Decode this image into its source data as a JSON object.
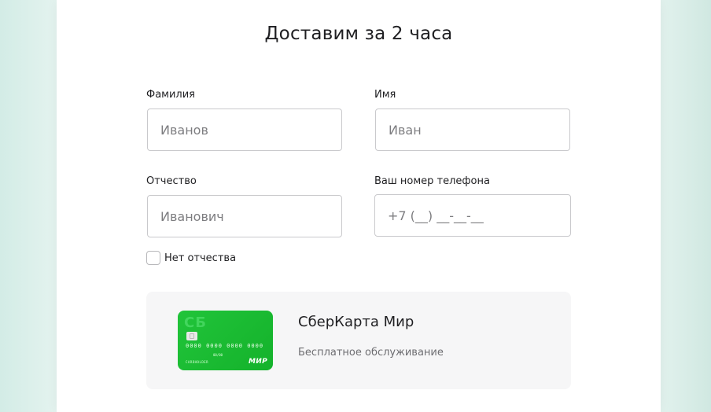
{
  "form": {
    "title": "Доставим за 2 часа",
    "surname": {
      "label": "Фамилия",
      "placeholder": "Иванов",
      "value": ""
    },
    "name": {
      "label": "Имя",
      "placeholder": "Иван",
      "value": ""
    },
    "patronymic": {
      "label": "Отчество",
      "placeholder": "Иванович",
      "value": ""
    },
    "phone": {
      "label": "Ваш номер телефона",
      "placeholder": "+7 (__) __-__-__",
      "value": ""
    },
    "no_patronymic": {
      "label": "Нет отчества",
      "checked": false
    }
  },
  "card_offer": {
    "title": "СберКарта Мир",
    "subtitle": "Бесплатное обслуживание",
    "card_image": {
      "logo": "СБ",
      "number": "0000 0000 0000 0000",
      "expiry": "00/00",
      "holder": "CARDHOLDER",
      "brand": "МИР"
    }
  },
  "colors": {
    "card_green": "#21c43a",
    "page_background": "#e4f3ef",
    "input_border": "#c9c9cc",
    "offer_background": "#f6f6f7"
  }
}
